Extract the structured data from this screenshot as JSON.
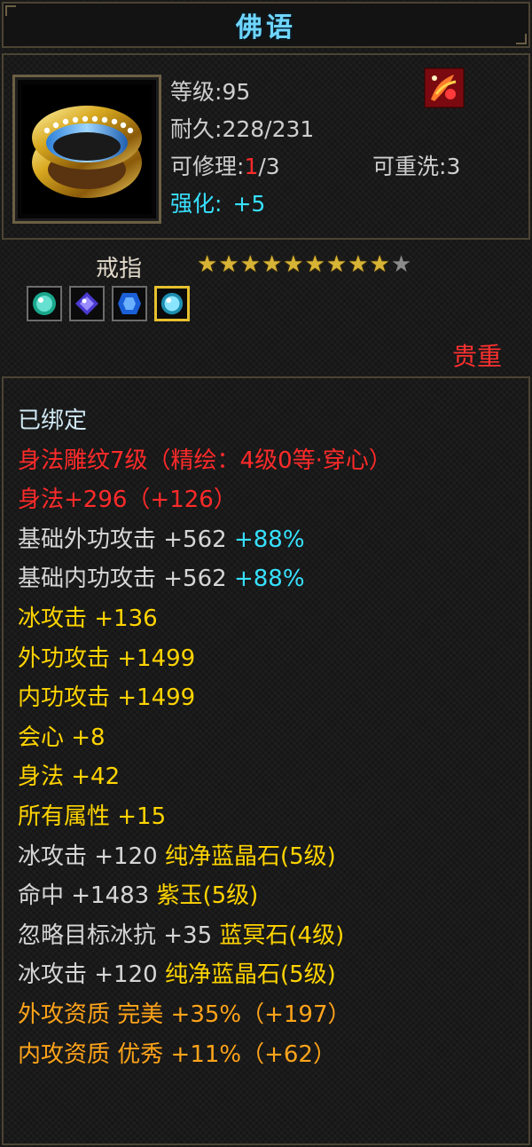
{
  "window": {
    "title": "佛语"
  },
  "item": {
    "level_label": "等级:",
    "level_value": "95",
    "durability_label": "耐久:",
    "durability_value": "228/231",
    "repair_label": "可修理:",
    "repair_current": "1",
    "repair_total": "/3",
    "rewash_label": "可重洗:",
    "rewash_value": "3",
    "enhance_label": "强化:",
    "enhance_value": "+5",
    "type": "戒指",
    "stars_filled": 9,
    "stars_total": 10,
    "gems": [
      "green-blue-gem",
      "purple-gem",
      "blue-gem",
      "cyan-gem"
    ],
    "selected_gem_index": 3,
    "rarity": "贵重"
  },
  "properties": [
    {
      "text": "已绑定",
      "color": "bound"
    },
    {
      "text": "身法雕纹7级（精绘：4级0等·穿心）",
      "color": "red"
    },
    {
      "text": "身法+296（+126）",
      "color": "red"
    },
    {
      "text": "基础外功攻击 +562 ",
      "extra": "+88%",
      "color": "white"
    },
    {
      "text": "基础内功攻击 +562 ",
      "extra": "+88%",
      "color": "white"
    },
    {
      "text": "冰攻击 +136",
      "color": "yellow"
    },
    {
      "text": "外功攻击 +1499",
      "color": "yellow"
    },
    {
      "text": "内功攻击 +1499",
      "color": "yellow"
    },
    {
      "text": "会心 +8",
      "color": "yellow"
    },
    {
      "text": "身法 +42",
      "color": "yellow"
    },
    {
      "text": "所有属性 +15",
      "color": "yellow"
    },
    {
      "text": "冰攻击 +120 ",
      "extra": "纯净蓝晶石(5级)",
      "color": "white",
      "extra_color": "yellow"
    },
    {
      "text": "命中 +1483 ",
      "extra": "紫玉(5级)",
      "color": "white",
      "extra_color": "yellow"
    },
    {
      "text": "忽略目标冰抗 +35 ",
      "extra": "蓝冥石(4级)",
      "color": "white",
      "extra_color": "yellow"
    },
    {
      "text": "冰攻击 +120 ",
      "extra": "纯净蓝晶石(5级)",
      "color": "white",
      "extra_color": "yellow"
    },
    {
      "text": "外攻资质  完美 +35%（+197）",
      "color": "orange"
    },
    {
      "text": "内攻资质  优秀 +11%（+62）",
      "color": "orange"
    }
  ],
  "colors": {
    "title": "#6fd6ff",
    "red": "#ff2a2a",
    "yellow": "#ffd400",
    "orange": "#ffa41a",
    "cyan": "#37e1ff",
    "white": "#d6d6d6",
    "border": "#4b4433"
  }
}
